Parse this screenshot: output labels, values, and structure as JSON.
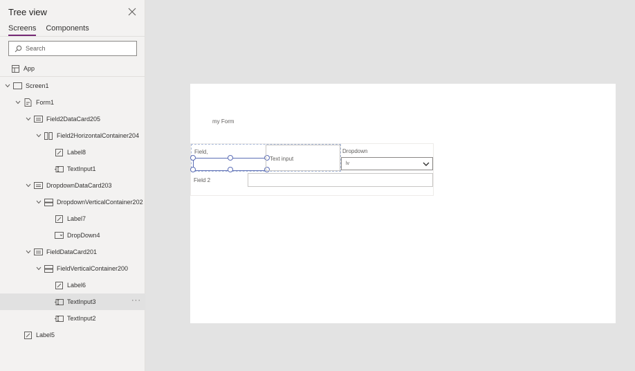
{
  "pane": {
    "title": "Tree view",
    "tabs": [
      {
        "label": "Screens",
        "active": true
      },
      {
        "label": "Components",
        "active": false
      }
    ],
    "search": {
      "placeholder": "Search",
      "value": ""
    },
    "app_label": "App",
    "nodes": [
      {
        "label": "Screen1",
        "icon": "screen-icon",
        "depth": 0,
        "chevron": true
      },
      {
        "label": "Form1",
        "icon": "form-icon",
        "depth": 1,
        "chevron": true
      },
      {
        "label": "Field2DataCard205",
        "icon": "card-icon",
        "depth": 2,
        "chevron": true
      },
      {
        "label": "Field2HorizontalContainer204",
        "icon": "horizontal-container-icon",
        "depth": 3,
        "chevron": true
      },
      {
        "label": "Label8",
        "icon": "label-icon",
        "depth": 4,
        "chevron": false
      },
      {
        "label": "TextInput1",
        "icon": "text-input-icon",
        "depth": 4,
        "chevron": false
      },
      {
        "label": "DropdownDataCard203",
        "icon": "card-icon",
        "depth": 2,
        "chevron": true
      },
      {
        "label": "DropdownVerticalContainer202",
        "icon": "vertical-container-icon",
        "depth": 3,
        "chevron": true
      },
      {
        "label": "Label7",
        "icon": "label-icon",
        "depth": 4,
        "chevron": false
      },
      {
        "label": "DropDown4",
        "icon": "dropdown-icon",
        "depth": 4,
        "chevron": false
      },
      {
        "label": "FieldDataCard201",
        "icon": "card-icon",
        "depth": 2,
        "chevron": true
      },
      {
        "label": "FieldVerticalContainer200",
        "icon": "vertical-container-icon",
        "depth": 3,
        "chevron": true
      },
      {
        "label": "Label6",
        "icon": "label-icon",
        "depth": 4,
        "chevron": false
      },
      {
        "label": "TextInput3",
        "icon": "text-input-icon",
        "depth": 4,
        "chevron": false,
        "selected": true,
        "more": "···"
      },
      {
        "label": "TextInput2",
        "icon": "text-input-icon",
        "depth": 4,
        "chevron": false
      },
      {
        "label": "Label5",
        "icon": "label-icon",
        "depth": 1,
        "chevron": false
      }
    ]
  },
  "canvas": {
    "form_title": "my Form",
    "field1_label": "Field,",
    "text_input_text": "Text input",
    "dropdown_label": "Dropdown",
    "dropdown_value": "lv",
    "field2_label": "Field 2"
  },
  "colors": {
    "accent": "#742774",
    "selection": "#5b6db5",
    "pane_bg": "#f3f2f1",
    "canvas_bg": "#e3e3e3"
  }
}
